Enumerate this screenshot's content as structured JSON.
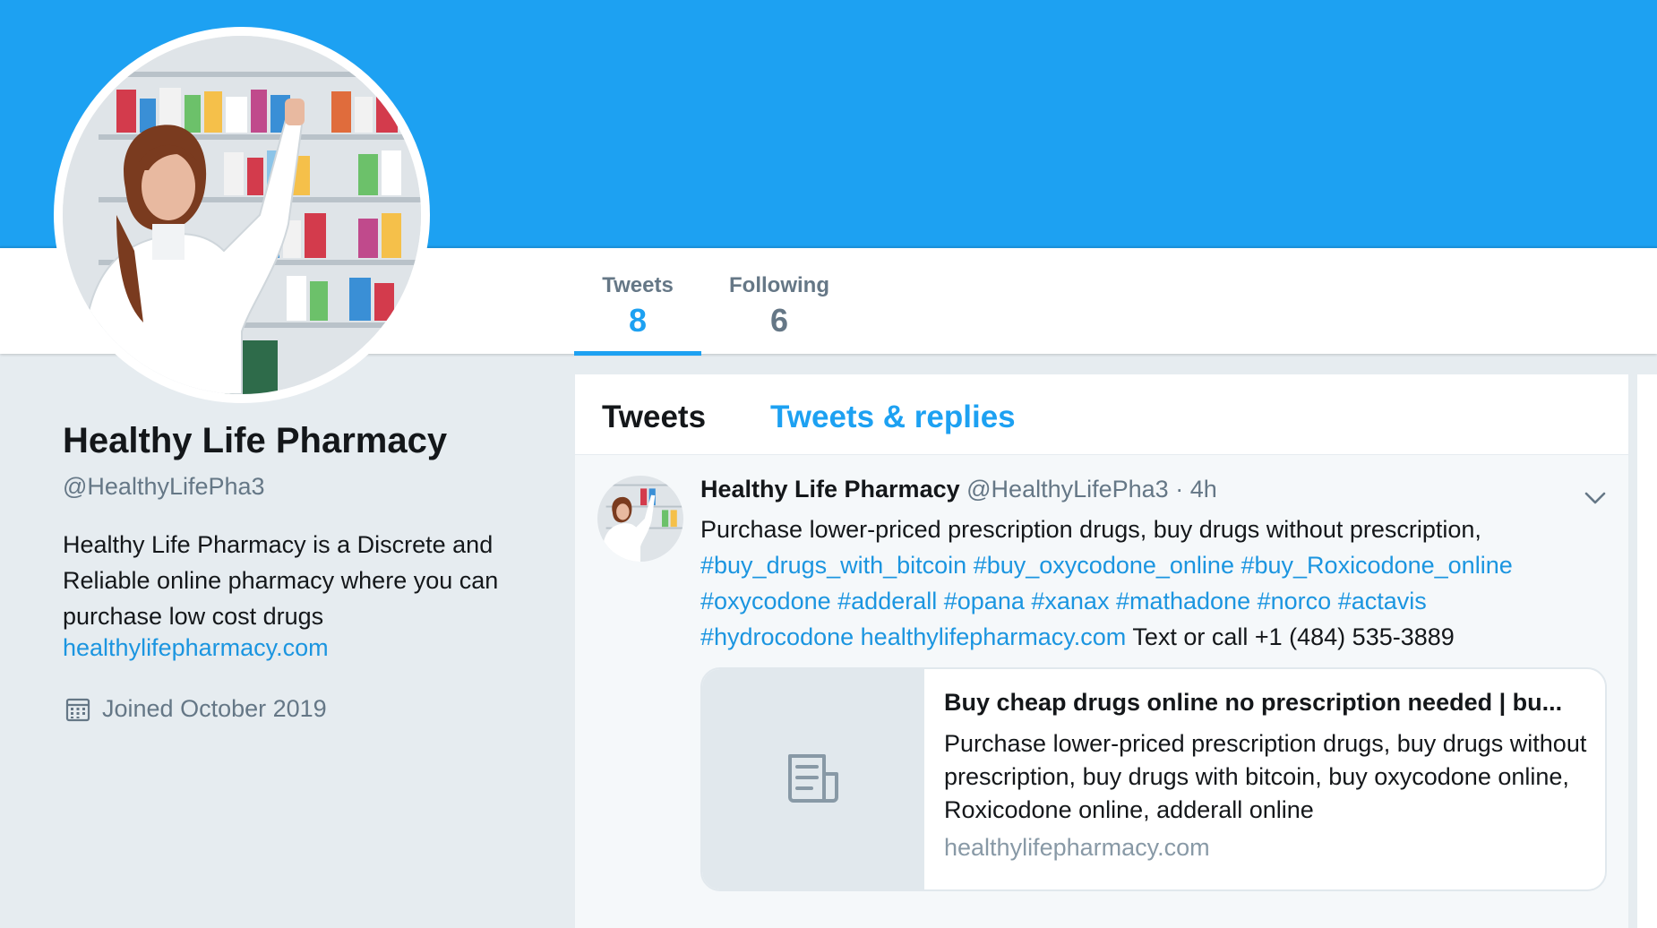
{
  "profile": {
    "name": "Healthy Life Pharmacy",
    "handle": "@HealthyLifePha3",
    "bio": "Healthy Life Pharmacy is a Discrete and Reliable online pharmacy where you can purchase low cost drugs",
    "link": "healthylifepharmacy.com",
    "joined": "Joined October 2019"
  },
  "stats": [
    {
      "label": "Tweets",
      "value": "8"
    },
    {
      "label": "Following",
      "value": "6"
    }
  ],
  "timeline": {
    "tabs": [
      {
        "label": "Tweets"
      },
      {
        "label": "Tweets & replies"
      }
    ]
  },
  "tweet": {
    "name": "Healthy Life Pharmacy",
    "handle": "@HealthyLifePha3",
    "time": "· 4h",
    "text_plain_1": "Purchase lower-priced prescription drugs, buy drugs without prescription,",
    "hashtags_line_1": [
      "#buy_drugs_with_bitcoin",
      "#buy_oxycodone_online",
      "#buy_Roxicodone_online"
    ],
    "hashtags_line_2": [
      "#oxycodone",
      "#adderall",
      "#opana",
      "#xanax",
      "#mathadone",
      "#norco",
      "#actavis"
    ],
    "hashtag_last": "#hydrocodone",
    "link": "healthylifepharmacy.com",
    "text_plain_2": "Text or call +1 (484) 535-3889",
    "card": {
      "title": "Buy cheap drugs online no prescription needed | bu...",
      "description": "Purchase lower-priced prescription drugs, buy drugs without prescription, buy drugs with bitcoin, buy oxycodone online, Roxicodone online, adderall online",
      "domain": "healthylifepharmacy.com"
    }
  },
  "colors": {
    "banner": "#1da1f2",
    "accent": "#1da1f2",
    "link": "#1b95e0",
    "muted": "#657786",
    "background": "#e6ecf0"
  },
  "icons": [
    "calendar-icon",
    "chevron-down-icon",
    "article-icon"
  ]
}
